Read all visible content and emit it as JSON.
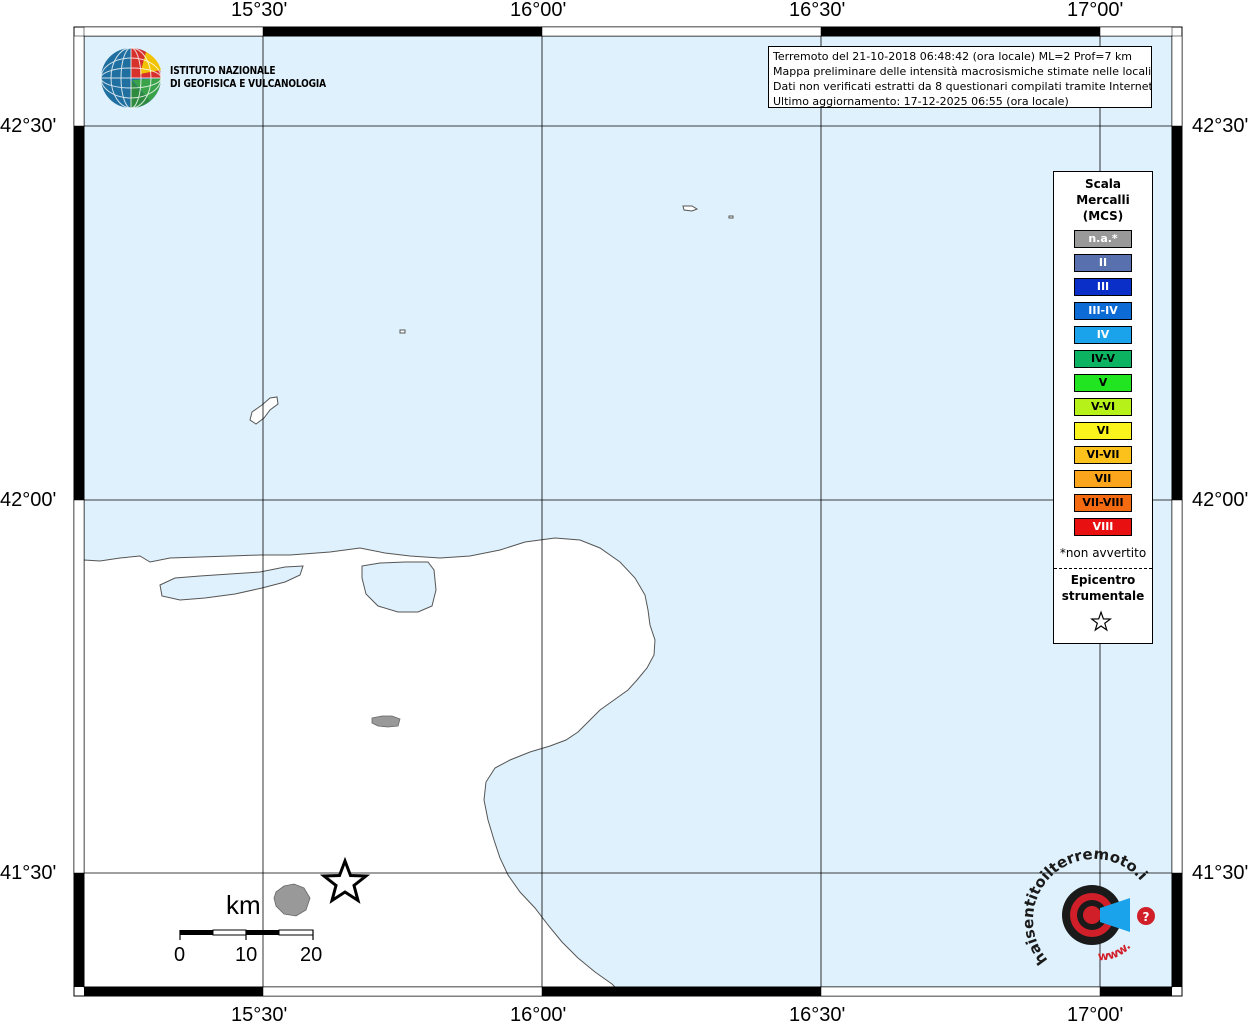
{
  "info": {
    "line1": "Terremoto del 21-10-2018 06:48:42 (ora locale) ML=2 Prof=7 km",
    "line2": "Mappa preliminare delle intensità macrosismiche stimate nelle località",
    "line3": "Dati non verificati estratti da 8 questionari compilati tramite Internet.",
    "line4": "Ultimo aggiornamento: 17-12-2025 06:55 (ora locale)"
  },
  "logo": {
    "line1": "ISTITUTO NAZIONALE",
    "line2": "DI GEOFISICA E VULCANOLOGIA"
  },
  "axes": {
    "top_labels": [
      "15°30'",
      "16°00'",
      "16°30'",
      "17°00'"
    ],
    "bottom_labels": [
      "15°30'",
      "16°00'",
      "16°30'",
      "17°00'"
    ],
    "left_labels": [
      "42°30'",
      "42°00'",
      "41°30'"
    ],
    "right_labels": [
      "42°30'",
      "42°00'",
      "41°30'"
    ]
  },
  "legend": {
    "title_line1": "Scala",
    "title_line2": "Mercalli",
    "title_line3": "(MCS)",
    "items": [
      {
        "label": "n.a.*",
        "color": "#999999",
        "text_color": "#ffffff"
      },
      {
        "label": "II",
        "color": "#5870ad",
        "text_color": "#ffffff"
      },
      {
        "label": "III",
        "color": "#0a2ec8",
        "text_color": "#ffffff"
      },
      {
        "label": "III-IV",
        "color": "#0d6bd6",
        "text_color": "#ffffff"
      },
      {
        "label": "IV",
        "color": "#1aa3ea",
        "text_color": "#ffffff"
      },
      {
        "label": "IV-V",
        "color": "#0cb462",
        "text_color": "#000000"
      },
      {
        "label": "V",
        "color": "#22e522",
        "text_color": "#000000"
      },
      {
        "label": "V-VI",
        "color": "#b6f21a",
        "text_color": "#000000"
      },
      {
        "label": "VI",
        "color": "#fbf41c",
        "text_color": "#000000"
      },
      {
        "label": "VI-VII",
        "color": "#fdc11c",
        "text_color": "#000000"
      },
      {
        "label": "VII",
        "color": "#fba51c",
        "text_color": "#000000"
      },
      {
        "label": "VII-VIII",
        "color": "#f46a10",
        "text_color": "#000000"
      },
      {
        "label": "VIII",
        "color": "#e81010",
        "text_color": "#ffffff"
      }
    ],
    "note": "*non avvertito",
    "epicenter_line1": "Epicentro",
    "epicenter_line2": "strumentale"
  },
  "scale_bar": {
    "unit": "km",
    "ticks": [
      "0",
      "10",
      "20"
    ]
  },
  "colors": {
    "sea": "#dff1fc",
    "land": "#ffffff",
    "frame": "#000000",
    "grid": "#000000",
    "felt_area": "#999999"
  },
  "watermark": {
    "text": "haisentitoilterremoto.it",
    "url_text": "www."
  }
}
